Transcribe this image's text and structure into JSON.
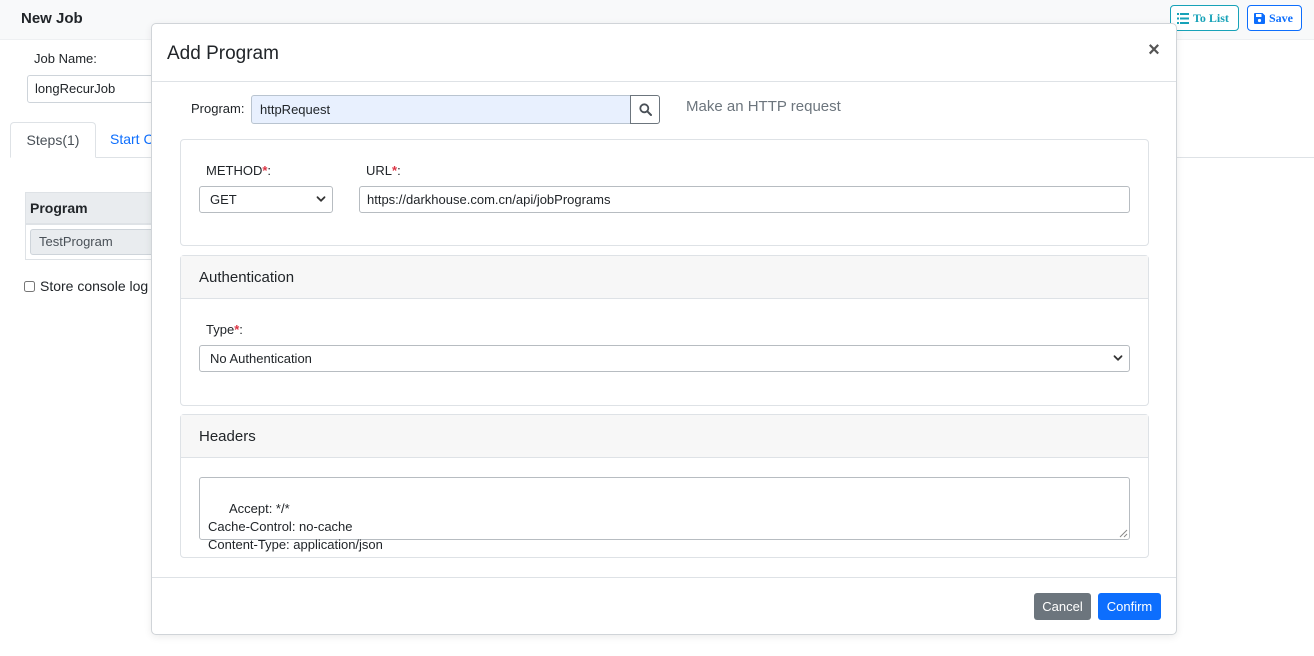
{
  "page": {
    "title": "New Job",
    "to_list_label": "To List",
    "save_label": "Save",
    "job_name_label": "Job Name:",
    "job_name_value": "longRecurJob",
    "tabs": [
      {
        "label": "Steps(1)"
      },
      {
        "label": "Start C"
      }
    ],
    "steps_table": {
      "header": "Program",
      "rows": [
        {
          "program": "TestProgram"
        }
      ]
    },
    "store_console_log_label": "Store console log"
  },
  "modal": {
    "title": "Add Program",
    "close_glyph": "×",
    "program_label": "Program:",
    "program_value": "httpRequest",
    "program_description": "Make an HTTP request",
    "method": {
      "label": "METHOD",
      "required_mark": "*",
      "suffix": ":",
      "selected": "GET"
    },
    "url": {
      "label": "URL",
      "required_mark": "*",
      "suffix": ":",
      "value": "https://darkhouse.com.cn/api/jobPrograms"
    },
    "authentication": {
      "heading": "Authentication",
      "type_label": "Type",
      "required_mark": "*",
      "suffix": ":",
      "selected": "No Authentication"
    },
    "headers": {
      "heading": "Headers",
      "value": "Accept: */*\nCache-Control: no-cache\nContent-Type: application/json"
    },
    "cancel_label": "Cancel",
    "confirm_label": "Confirm"
  },
  "colors": {
    "primary": "#0d6efd",
    "info": "#17a2b8",
    "secondary": "#6c757d",
    "required": "#dc3545",
    "autofill": "#e8f0fe"
  },
  "icons": {
    "to_list": "list-icon",
    "save": "floppy-icon",
    "search": "search-icon",
    "close": "close-icon",
    "select": "chevron-down-icon"
  }
}
